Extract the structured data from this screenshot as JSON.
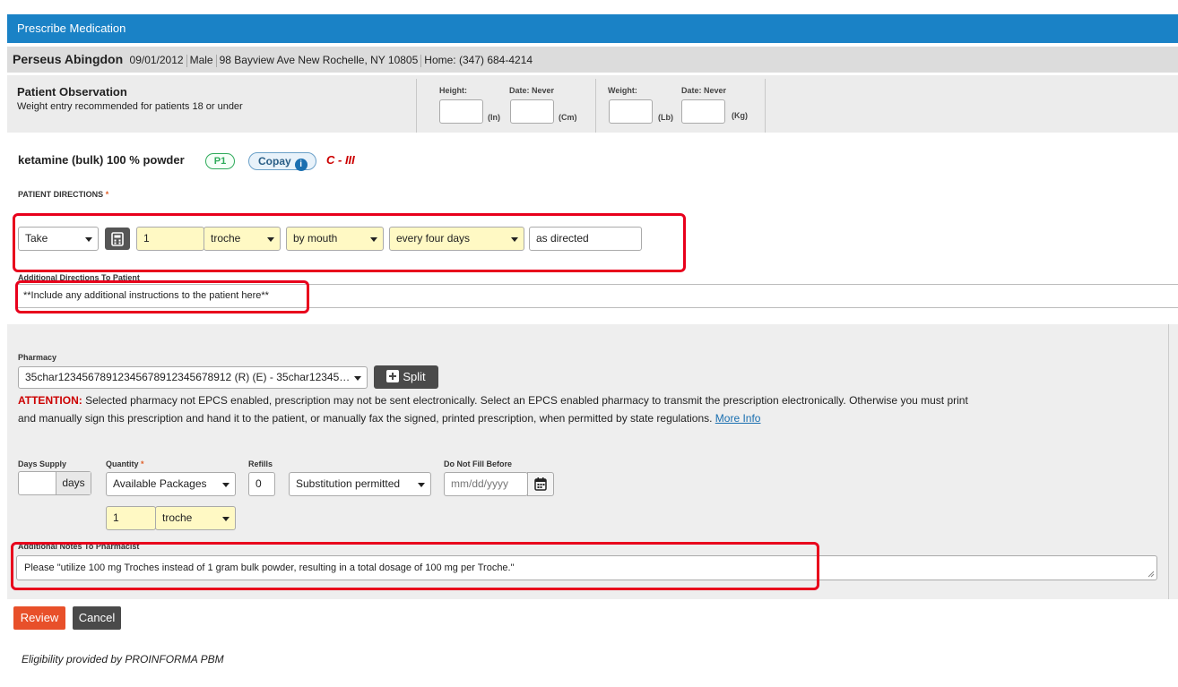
{
  "window": {
    "title": "Prescribe Medication"
  },
  "patient": {
    "name": "Perseus Abingdon",
    "dob": "09/01/2012",
    "sex": "Male",
    "address": "98 Bayview Ave New Rochelle, NY 10805",
    "phone": "Home: (347) 684-4214"
  },
  "observation": {
    "title": "Patient Observation",
    "subtitle": "Weight entry recommended for patients 18 or under",
    "height_label": "Height:",
    "height_date": "Date: Never",
    "height_unit_in": "(In)",
    "height_unit_cm": "(Cm)",
    "weight_label": "Weight:",
    "weight_date": "Date: Never",
    "weight_unit_lb": "(Lb)",
    "weight_unit_kg": "(Kg)"
  },
  "medication": {
    "name": "ketamine (bulk) 100 % powder",
    "tier_badge": "P1",
    "copay_label": "Copay",
    "info_glyph": "i",
    "schedule": "C - III"
  },
  "directions": {
    "label": "PATIENT DIRECTIONS",
    "required_mark": "*",
    "action": "Take",
    "quantity": "1",
    "unit": "troche",
    "route": "by mouth",
    "frequency": "every four days",
    "extra": "as directed",
    "additional_label": "Additional Directions To Patient",
    "additional_value": "**Include any additional instructions to the patient here**"
  },
  "pharmacy": {
    "label": "Pharmacy",
    "selected": "35char12345678912345678912345678912 (R) (E) - 35char12345…",
    "split_label": "Split",
    "attention_label": "ATTENTION:",
    "attention_text": " Selected pharmacy not EPCS enabled, prescription may not be sent electronically. Select an EPCS enabled pharmacy to transmit the prescription electronically. Otherwise you must print and manually sign this prescription and hand it to the patient, or manually fax the signed, printed prescription, when permitted by state regulations. ",
    "more_info": "More Info"
  },
  "dispense": {
    "days_supply_label": "Days Supply",
    "days_supply_value": "",
    "days_unit": "days",
    "quantity_label": "Quantity",
    "quantity_required": "*",
    "quantity_select": "Available Packages",
    "quantity_value": "1",
    "quantity_unit": "troche",
    "refills_label": "Refills",
    "refills_value": "0",
    "substitution": "Substitution permitted",
    "dnfb_label": "Do Not Fill Before",
    "dnfb_placeholder": "mm/dd/yyyy"
  },
  "notes": {
    "label": "Additional Notes To Pharmacist",
    "value": "Please \"utilize 100 mg Troches instead of 1 gram bulk powder, resulting in a total dosage of 100 mg per Troche.\""
  },
  "actions": {
    "review": "Review",
    "cancel": "Cancel"
  },
  "footer": {
    "eligibility": "Eligibility provided by PROINFORMA PBM"
  },
  "colors": {
    "header": "#1a82c6",
    "highlight_border": "#e8001c",
    "review": "#e8502a",
    "schedule": "#cc0000"
  }
}
